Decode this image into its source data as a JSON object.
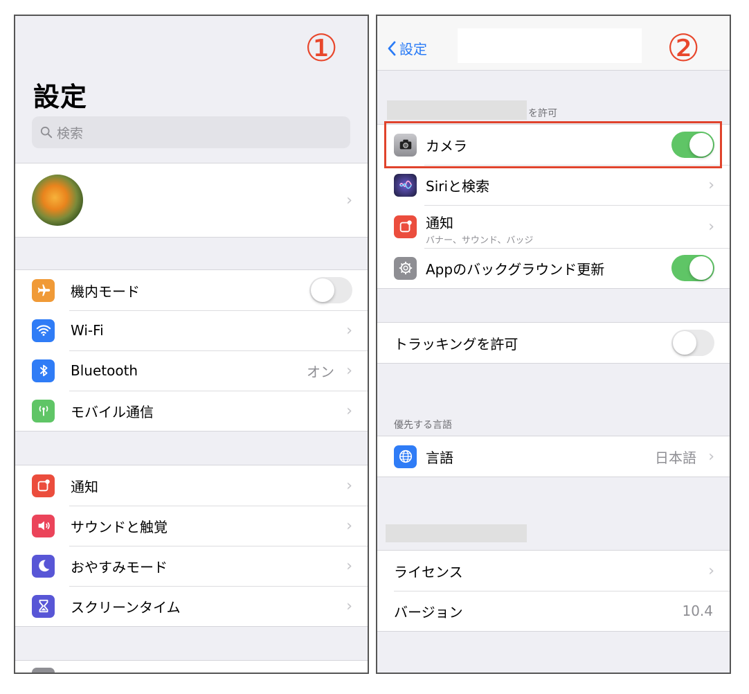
{
  "panel1": {
    "step_marker": "①",
    "title": "設定",
    "search_placeholder": "検索",
    "group2": [
      {
        "label": "機内モード",
        "icon": "airplane-icon",
        "color": "#f09a37",
        "control": "toggle-off"
      },
      {
        "label": "Wi-Fi",
        "icon": "wifi-icon",
        "color": "#2f7cf6",
        "control": "chevron"
      },
      {
        "label": "Bluetooth",
        "icon": "bluetooth-icon",
        "color": "#2f7cf6",
        "control": "chevron",
        "value": "オン"
      },
      {
        "label": "モバイル通信",
        "icon": "antenna-icon",
        "color": "#5fc566",
        "control": "chevron"
      }
    ],
    "group3": [
      {
        "label": "通知",
        "icon": "notifications-icon",
        "color": "#eb4d3d",
        "control": "chevron"
      },
      {
        "label": "サウンドと触覚",
        "icon": "speaker-icon",
        "color": "#eb445a",
        "control": "chevron"
      },
      {
        "label": "おやすみモード",
        "icon": "moon-icon",
        "color": "#5856d6",
        "control": "chevron"
      },
      {
        "label": "スクリーンタイム",
        "icon": "hourglass-icon",
        "color": "#5856d6",
        "control": "chevron"
      }
    ]
  },
  "panel2": {
    "step_marker": "②",
    "back_label": "設定",
    "section_allow_suffix": "を許可",
    "allow_items": [
      {
        "label": "カメラ",
        "icon": "camera-icon",
        "color": "#8e8e93",
        "control": "toggle-on"
      },
      {
        "label": "Siriと検索",
        "icon": "siri-icon",
        "color": "#1c1c3a",
        "control": "chevron"
      },
      {
        "label": "通知",
        "sublabel": "バナー、サウンド、バッジ",
        "icon": "notifications-icon",
        "color": "#eb4d3d",
        "control": "chevron"
      },
      {
        "label": "Appのバックグラウンド更新",
        "icon": "gear-icon",
        "color": "#8e8e93",
        "control": "toggle-on"
      }
    ],
    "tracking_label": "トラッキングを許可",
    "language_header": "優先する言語",
    "language_label": "言語",
    "language_value": "日本語",
    "license_label": "ライセンス",
    "version_label": "バージョン",
    "version_value": "10.4"
  }
}
